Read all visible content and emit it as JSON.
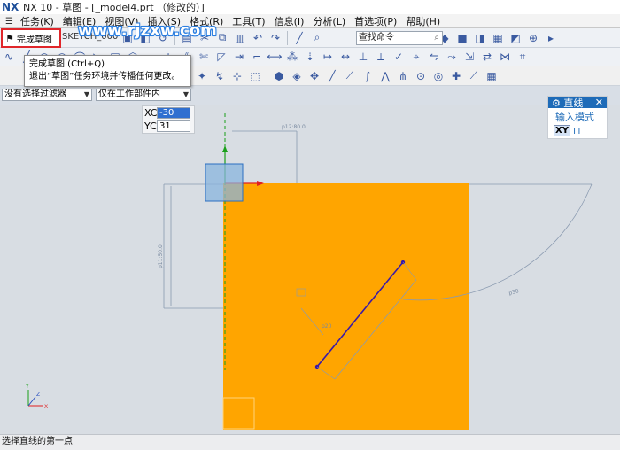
{
  "window": {
    "logo": "NX",
    "title": "NX 10 - 草图 - [_model4.prt （修改的）]"
  },
  "watermark": "www.rjzxw.com",
  "menubar": {
    "items": [
      "任务(K)",
      "编辑(E)",
      "视图(V)",
      "插入(S)",
      "格式(R)",
      "工具(T)",
      "信息(I)",
      "分析(L)",
      "首选项(P)",
      "帮助(H)"
    ]
  },
  "toolbar": {
    "finish_sketch_label": "完成草图",
    "sketch_name": "SKETCH_000",
    "search_placeholder": "查找命令"
  },
  "tooltip": {
    "title": "完成草图 (Ctrl+Q)",
    "description": "退出“草图”任务环境并传播任何更改。"
  },
  "filters": {
    "selection_filter": "没有选择过滤器",
    "scope": "仅在工作部件内"
  },
  "coordinates": {
    "xc_label": "XC",
    "xc_value": "-30",
    "yc_label": "YC",
    "yc_value": "31"
  },
  "line_panel": {
    "title": "直线",
    "input_mode_label": "输入模式",
    "xy_label": "XY",
    "close_icon": "close-icon",
    "gear_icon": "gear-icon"
  },
  "sketch": {
    "dimensions": [
      "p12:80.0",
      "p11:50.0",
      "p20",
      "p30"
    ],
    "colors": {
      "sketch_fill": "#ffa500",
      "line": "#3a1aa6",
      "dimension": "#8a9ab0",
      "axis_x": "#e02020",
      "axis_y": "#1aa01a"
    }
  },
  "axis_triad": {
    "x": "X",
    "y": "Y",
    "z": "Z"
  },
  "status": {
    "prompt": "选择直线的第一点"
  }
}
